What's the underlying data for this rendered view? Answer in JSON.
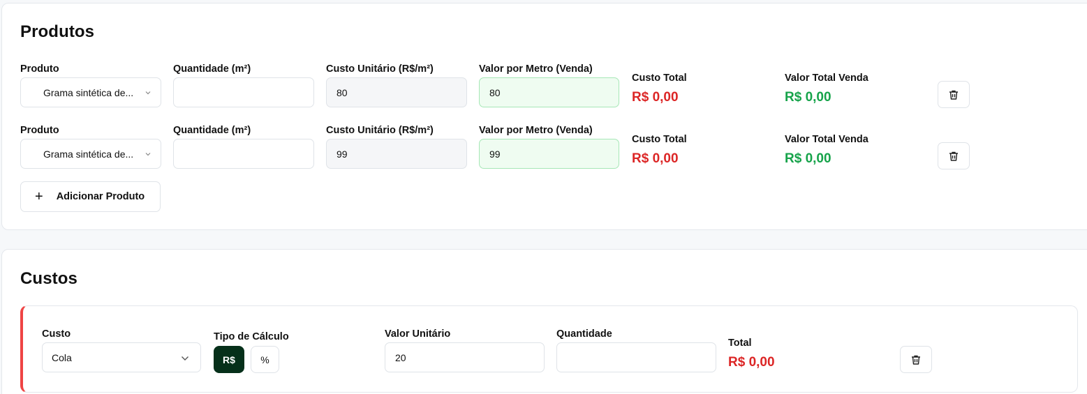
{
  "products": {
    "title": "Produtos",
    "labels": {
      "product": "Produto",
      "quantity": "Quantidade (m²)",
      "unit_cost": "Custo Unitário (R$/m²)",
      "price_per_meter": "Valor por Metro (Venda)",
      "total_cost": "Custo Total",
      "total_sale": "Valor Total Venda"
    },
    "rows": [
      {
        "product": "Grama sintética de...",
        "quantity": "",
        "unit_cost": "80",
        "price_per_meter": "80",
        "total_cost": "R$ 0,00",
        "total_sale": "R$ 0,00"
      },
      {
        "product": "Grama sintética de...",
        "quantity": "",
        "unit_cost": "99",
        "price_per_meter": "99",
        "total_cost": "R$ 0,00",
        "total_sale": "R$ 0,00"
      }
    ],
    "add_button": "Adicionar Produto",
    "add_icon": "plus-icon",
    "delete_icon": "trash-icon"
  },
  "costs": {
    "title": "Custos",
    "labels": {
      "cost": "Custo",
      "calc_type": "Tipo de Cálculo",
      "unit_value": "Valor Unitário",
      "quantity": "Quantidade",
      "total": "Total"
    },
    "rows": [
      {
        "cost": "Cola",
        "calc_options": [
          "R$",
          "%"
        ],
        "calc_selected": "R$",
        "unit_value": "20",
        "quantity": "",
        "total": "R$ 0,00"
      }
    ],
    "accent_color": "#ef4444"
  },
  "colors": {
    "negative": "#dc2626",
    "positive": "#16a34a",
    "active_toggle": "#06301a",
    "sale_field_bg": "#effcf1"
  }
}
